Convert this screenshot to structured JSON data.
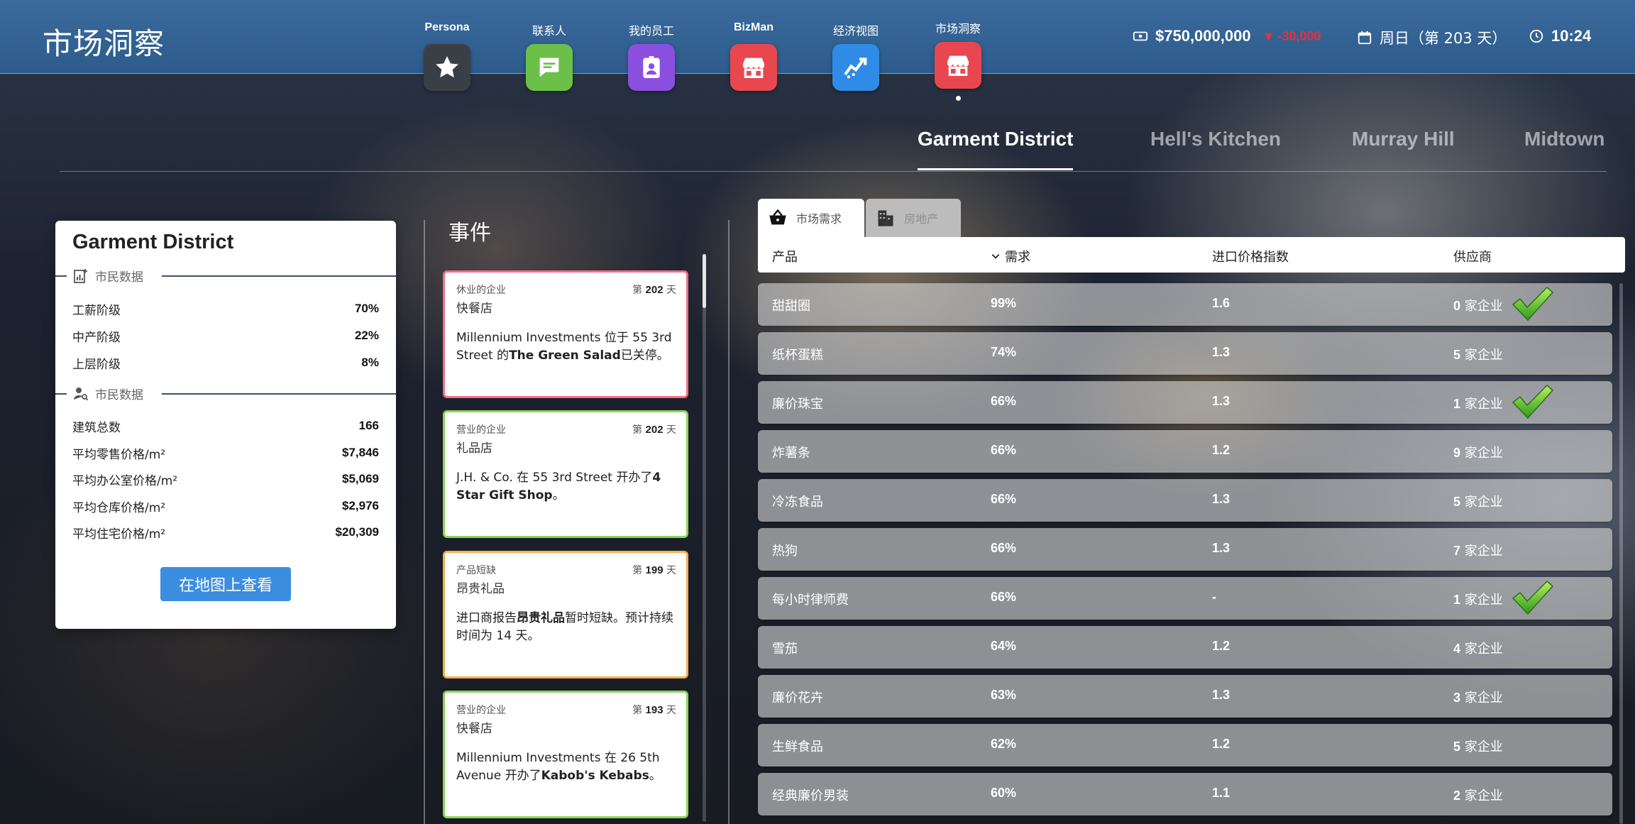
{
  "header": {
    "title": "市场洞察",
    "nav": [
      {
        "label": "Persona",
        "icon": "star-icon",
        "color": "#3a3f46"
      },
      {
        "label": "联系人",
        "icon": "chat-icon",
        "color": "#6cc04a"
      },
      {
        "label": "我的员工",
        "icon": "badge-icon",
        "color": "#8b4fe0"
      },
      {
        "label": "BizMan",
        "icon": "shop-icon",
        "color": "#e8474f"
      },
      {
        "label": "经济视图",
        "icon": "chart-icon",
        "color": "#2f8be6"
      },
      {
        "label": "市场洞察",
        "icon": "shop-icon",
        "color": "#e8474f"
      }
    ],
    "money": "$750,000,000",
    "money_change": "-30,000",
    "date": "周日（第 203 天）",
    "time": "10:24"
  },
  "district_tabs": [
    "Garment District",
    "Hell's Kitchen",
    "Murray Hill",
    "Midtown"
  ],
  "district_info": {
    "title": "Garment District",
    "section1_label": "市民数据",
    "demographics": [
      {
        "label": "工薪阶级",
        "value": "70%"
      },
      {
        "label": "中产阶级",
        "value": "22%"
      },
      {
        "label": "上层阶级",
        "value": "8%"
      }
    ],
    "section2_label": "市民数据",
    "stats": [
      {
        "label": "建筑总数",
        "value": "166"
      },
      {
        "label": "平均零售价格/m²",
        "value": "$7,846"
      },
      {
        "label": "平均办公室价格/m²",
        "value": "$5,069"
      },
      {
        "label": "平均仓库价格/m²",
        "value": "$2,976"
      },
      {
        "label": "平均住宅价格/m²",
        "value": "$20,309"
      }
    ],
    "map_button": "在地图上查看"
  },
  "events": {
    "title": "事件",
    "day_prefix": "第",
    "day_suffix": "天",
    "items": [
      {
        "type": "休业的企业",
        "day": "202",
        "subtitle": "快餐店",
        "border": "#f07080",
        "body": [
          {
            "t": "Millennium Investments 位于 55 3rd Street 的"
          },
          {
            "t": "The Green Salad",
            "b": true
          },
          {
            "t": "已关停。"
          }
        ]
      },
      {
        "type": "营业的企业",
        "day": "202",
        "subtitle": "礼品店",
        "border": "#8ad45a",
        "body": [
          {
            "t": "J.H. & Co. 在 55 3rd Street 开办了"
          },
          {
            "t": "4 Star Gift Shop",
            "b": true
          },
          {
            "t": "。"
          }
        ]
      },
      {
        "type": "产品短缺",
        "day": "199",
        "subtitle": "昂贵礼品",
        "border": "#f5b04a",
        "body": [
          {
            "t": "进口商报告"
          },
          {
            "t": "昂贵礼品",
            "b": true
          },
          {
            "t": "暂时短缺。预计持续时间为 14 天。"
          }
        ]
      },
      {
        "type": "营业的企业",
        "day": "193",
        "subtitle": "快餐店",
        "border": "#8ad45a",
        "body": [
          {
            "t": "Millennium Investments 在 26 5th Avenue 开办了"
          },
          {
            "t": "Kabob's Kebabs",
            "b": true
          },
          {
            "t": "。"
          }
        ]
      }
    ]
  },
  "market": {
    "tab_demand": "市场需求",
    "tab_realestate": "房地产",
    "columns": {
      "product": "产品",
      "demand": "需求",
      "price": "进口价格指数",
      "supplier": "供应商"
    },
    "supplier_suffix": "家企业",
    "rows": [
      {
        "product": "甜甜圈",
        "demand": "99%",
        "price": "1.6",
        "suppliers": "0",
        "check": true
      },
      {
        "product": "纸杯蛋糕",
        "demand": "74%",
        "price": "1.3",
        "suppliers": "5",
        "check": false
      },
      {
        "product": "廉价珠宝",
        "demand": "66%",
        "price": "1.3",
        "suppliers": "1",
        "check": true
      },
      {
        "product": "炸薯条",
        "demand": "66%",
        "price": "1.2",
        "suppliers": "9",
        "check": false
      },
      {
        "product": "冷冻食品",
        "demand": "66%",
        "price": "1.3",
        "suppliers": "5",
        "check": false
      },
      {
        "product": "热狗",
        "demand": "66%",
        "price": "1.3",
        "suppliers": "7",
        "check": false
      },
      {
        "product": "每小时律师费",
        "demand": "66%",
        "price": "-",
        "suppliers": "1",
        "check": true
      },
      {
        "product": "雪茄",
        "demand": "64%",
        "price": "1.2",
        "suppliers": "4",
        "check": false
      },
      {
        "product": "廉价花卉",
        "demand": "63%",
        "price": "1.3",
        "suppliers": "3",
        "check": false
      },
      {
        "product": "生鲜食品",
        "demand": "62%",
        "price": "1.2",
        "suppliers": "5",
        "check": false
      },
      {
        "product": "经典廉价男装",
        "demand": "60%",
        "price": "1.1",
        "suppliers": "2",
        "check": false
      }
    ]
  }
}
